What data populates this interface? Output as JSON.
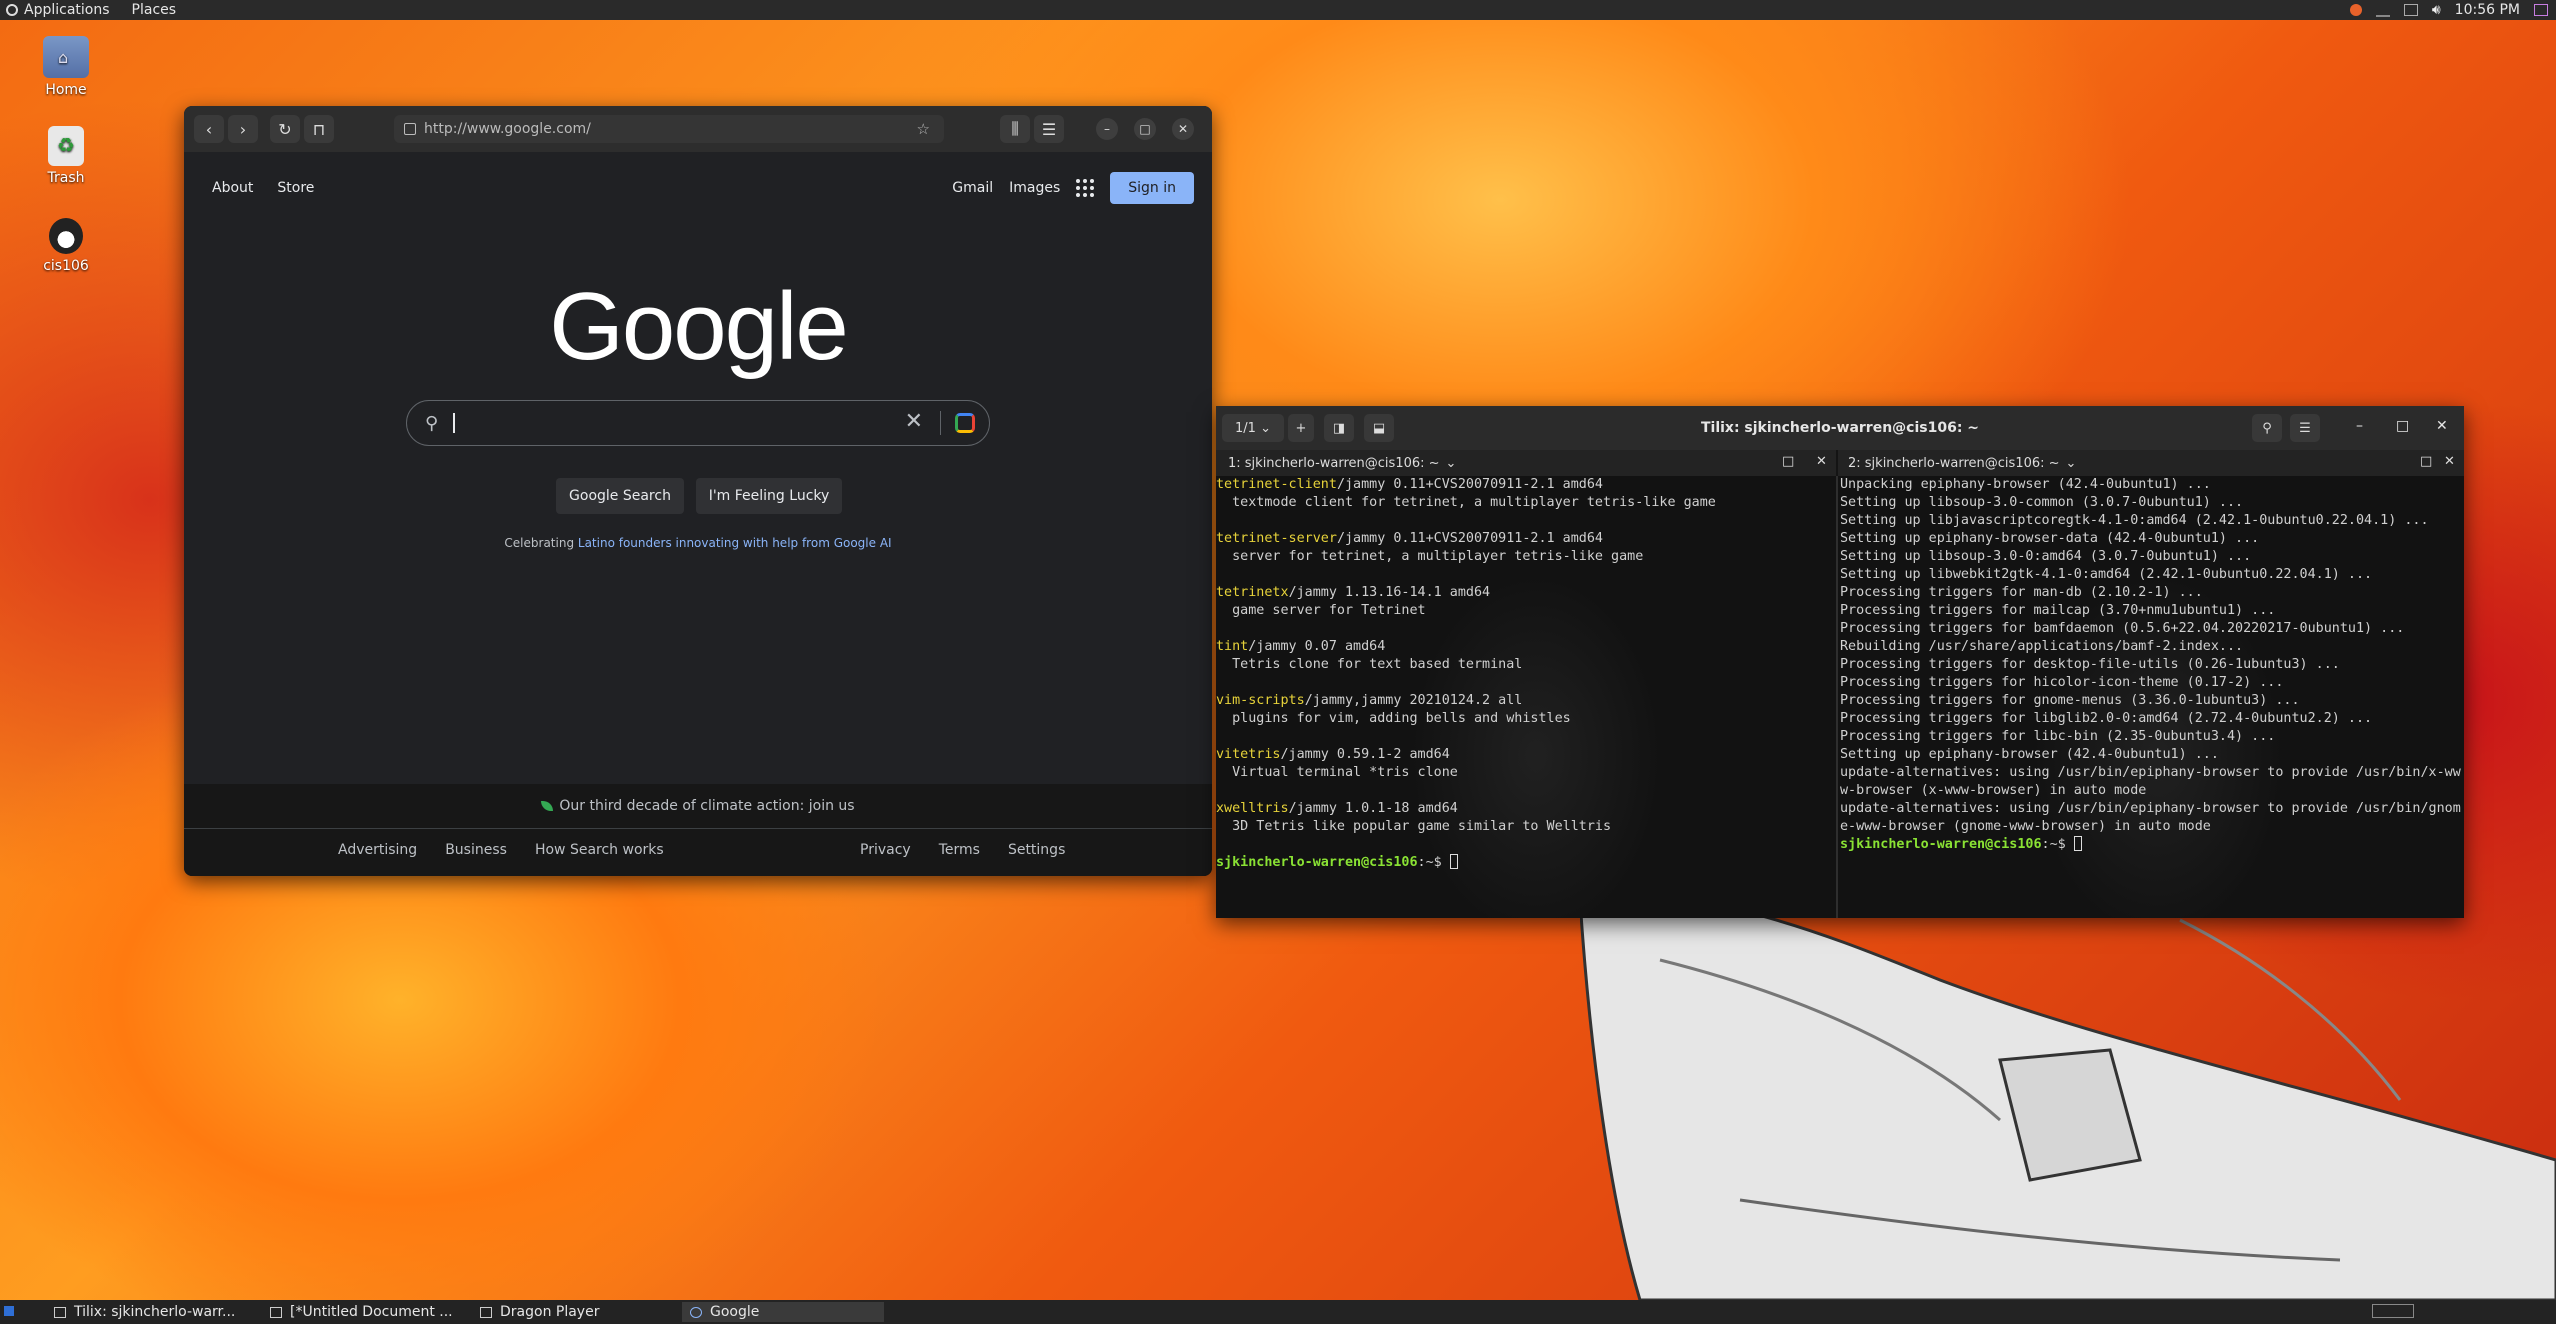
{
  "top_panel": {
    "applications": "Applications",
    "places": "Places",
    "clock": "10:56 PM"
  },
  "desktop": {
    "icons": [
      {
        "label": "Home",
        "icon": "home-folder-icon"
      },
      {
        "label": "Trash",
        "icon": "trash-icon"
      },
      {
        "label": "cis106",
        "icon": "user-icon"
      }
    ]
  },
  "browser": {
    "url": "http://www.google.com/",
    "top_left": [
      "About",
      "Store"
    ],
    "top_right": [
      "Gmail",
      "Images"
    ],
    "sign_in": "Sign in",
    "logo": "Google",
    "search_button": "Google Search",
    "lucky_button": "I'm Feeling Lucky",
    "celebrating_prefix": "Celebrating ",
    "celebrating_link": "Latino founders innovating with help from Google AI",
    "climate": "Our third decade of climate action: join us",
    "footer_left": [
      "Advertising",
      "Business",
      "How Search works"
    ],
    "footer_right": [
      "Privacy",
      "Terms",
      "Settings"
    ]
  },
  "terminal": {
    "title": "Tilix: sjkincherlo-warren@cis106: ~",
    "session_counter": "1/1",
    "pane1_title": "1: sjkincherlo-warren@cis106: ~",
    "pane2_title": "2: sjkincherlo-warren@cis106: ~",
    "pane1_lines": [
      {
        "pkg": "tetrinet-client",
        "rest": "/jammy 0.11+CVS20070911-2.1 amd64"
      },
      {
        "desc": "  textmode client for tetrinet, a multiplayer tetris-like game"
      },
      {
        "blank": ""
      },
      {
        "pkg": "tetrinet-server",
        "rest": "/jammy 0.11+CVS20070911-2.1 amd64"
      },
      {
        "desc": "  server for tetrinet, a multiplayer tetris-like game"
      },
      {
        "blank": ""
      },
      {
        "pkg": "tetrinetx",
        "rest": "/jammy 1.13.16-14.1 amd64"
      },
      {
        "desc": "  game server for Tetrinet"
      },
      {
        "blank": ""
      },
      {
        "pkg": "tint",
        "rest": "/jammy 0.07 amd64"
      },
      {
        "desc": "  Tetris clone for text based terminal"
      },
      {
        "blank": ""
      },
      {
        "pkg": "vim-scripts",
        "rest": "/jammy,jammy 20210124.2 all"
      },
      {
        "desc": "  plugins for vim, adding bells and whistles"
      },
      {
        "blank": ""
      },
      {
        "pkg": "vitetris",
        "rest": "/jammy 0.59.1-2 amd64"
      },
      {
        "desc": "  Virtual terminal *tris clone"
      },
      {
        "blank": ""
      },
      {
        "pkg": "xwelltris",
        "rest": "/jammy 1.0.1-18 amd64"
      },
      {
        "desc": "  3D Tetris like popular game similar to Welltris"
      }
    ],
    "prompt": "sjkincherlo-warren@cis106",
    "prompt_suffix": ":~$ ",
    "pane2_lines": [
      "Unpacking epiphany-browser (42.4-0ubuntu1) ...",
      "Setting up libsoup-3.0-common (3.0.7-0ubuntu1) ...",
      "Setting up libjavascriptcoregtk-4.1-0:amd64 (2.42.1-0ubuntu0.22.04.1) ...",
      "Setting up epiphany-browser-data (42.4-0ubuntu1) ...",
      "Setting up libsoup-3.0-0:amd64 (3.0.7-0ubuntu1) ...",
      "Setting up libwebkit2gtk-4.1-0:amd64 (2.42.1-0ubuntu0.22.04.1) ...",
      "Processing triggers for man-db (2.10.2-1) ...",
      "Processing triggers for mailcap (3.70+nmu1ubuntu1) ...",
      "Processing triggers for bamfdaemon (0.5.6+22.04.20220217-0ubuntu1) ...",
      "Rebuilding /usr/share/applications/bamf-2.index...",
      "Processing triggers for desktop-file-utils (0.26-1ubuntu3) ...",
      "Processing triggers for hicolor-icon-theme (0.17-2) ...",
      "Processing triggers for gnome-menus (3.36.0-1ubuntu3) ...",
      "Processing triggers for libglib2.0-0:amd64 (2.72.4-0ubuntu2.2) ...",
      "Processing triggers for libc-bin (2.35-0ubuntu3.4) ...",
      "Setting up epiphany-browser (42.4-0ubuntu1) ...",
      "update-alternatives: using /usr/bin/epiphany-browser to provide /usr/bin/x-ww",
      "w-browser (x-www-browser) in auto mode",
      "update-alternatives: using /usr/bin/epiphany-browser to provide /usr/bin/gnom",
      "e-www-browser (gnome-www-browser) in auto mode"
    ]
  },
  "taskbar": {
    "items": [
      "Tilix: sjkincherlo-warr...",
      "[*Untitled Document ...",
      "Dragon Player",
      "Google"
    ]
  }
}
